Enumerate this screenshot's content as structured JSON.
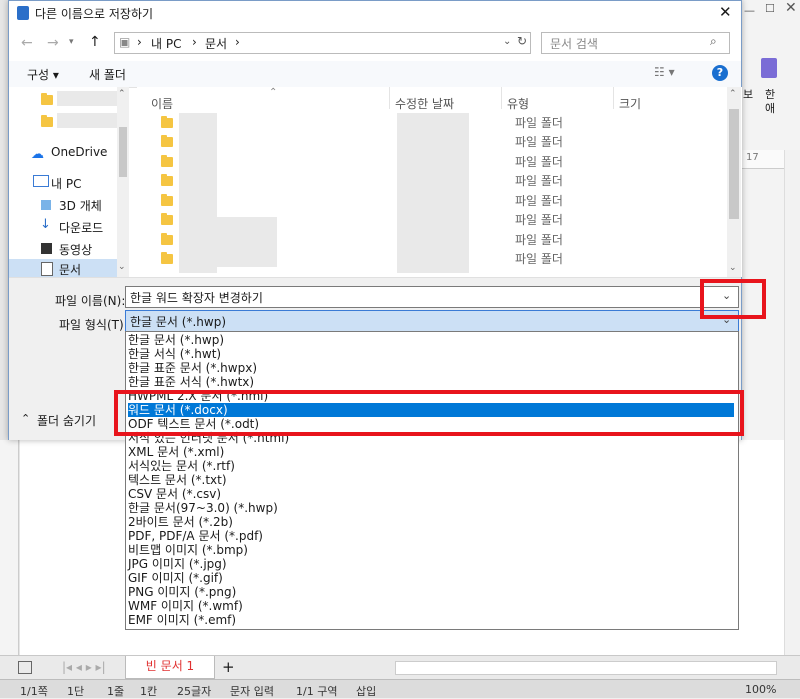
{
  "dialog": {
    "title": "다른 이름으로 저장하기",
    "breadcrumb": [
      "내 PC",
      "문서"
    ],
    "search_placeholder": "문서 검색",
    "toolbar": {
      "organize": "구성 ▾",
      "new_folder": "새 폴더"
    },
    "nav": {
      "onedrive": "OneDrive",
      "this_pc": "내 PC",
      "objects3d": "3D 개체",
      "downloads": "다운로드",
      "videos": "동영상",
      "documents": "문서"
    },
    "columns": {
      "name": "이름",
      "modified": "수정한 날짜",
      "type": "유형",
      "size": "크기"
    },
    "file_types": [
      "파일 폴더",
      "파일 폴더",
      "파일 폴더",
      "파일 폴더",
      "파일 폴더",
      "파일 폴더",
      "파일 폴더",
      "파일 폴더"
    ],
    "filename_label": "파일 이름(N):",
    "filename_value": "한글 워드 확장자 변경하기",
    "filetype_label": "파일 형식(T):",
    "filetype_value": "한글 문서 (*.hwp)",
    "hide_folders": "폴더 숨기기",
    "options": [
      "한글 문서 (*.hwp)",
      "한글 서식 (*.hwt)",
      "한글 표준 문서 (*.hwpx)",
      "한글 표준 서식 (*.hwtx)",
      "HWPML 2.X 문서 (*.hml)",
      "워드 문서 (*.docx)",
      "ODF 텍스트 문서 (*.odt)",
      "서식 있는 인터넷 문서 (*.html)",
      "XML 문서 (*.xml)",
      "서식있는 문서 (*.rtf)",
      "텍스트 문서 (*.txt)",
      "CSV 문서 (*.csv)",
      "한글 문서(97~3.0) (*.hwp)",
      "2바이트 문서 (*.2b)",
      "PDF, PDF/A 문서 (*.pdf)",
      "비트맵 이미지 (*.bmp)",
      "JPG 이미지 (*.jpg)",
      "GIF 이미지 (*.gif)",
      "PNG 이미지 (*.png)",
      "WMF 이미지 (*.wmf)",
      "EMF 이미지 (*.emf)"
    ],
    "selected_index": 5
  },
  "app": {
    "right_panel_top": "보",
    "right_panel_top2": "한",
    "right_panel_top3": "애",
    "ruler_mark": "17",
    "tab_name": "빈 문서 1",
    "status": [
      "1/1쪽",
      "1단",
      "1줄",
      "1칸",
      "25글자",
      "문자 입력",
      "1/1 구역",
      "삽입"
    ],
    "zoom": "100%"
  },
  "colors": {
    "selection": "#0078d7",
    "highlight_box": "#e8141c",
    "folder": "#f5c542"
  }
}
